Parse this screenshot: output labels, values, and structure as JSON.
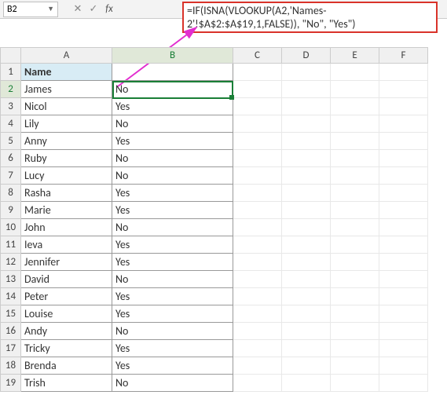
{
  "name_box": {
    "value": "B2"
  },
  "fx": {
    "cancel": "✕",
    "confirm": "✓",
    "label": "fx"
  },
  "formula": "=IF(ISNA(VLOOKUP(A2,'Names-2'!$A$2:$A$19,1,FALSE)), \"No\", \"Yes\")",
  "columns": [
    "A",
    "B",
    "C",
    "D",
    "E",
    "F"
  ],
  "row_numbers": [
    1,
    2,
    3,
    4,
    5,
    6,
    7,
    8,
    9,
    10,
    11,
    12,
    13,
    14,
    15,
    16,
    17,
    18,
    19
  ],
  "header": {
    "name_label": "Name"
  },
  "rows": [
    {
      "name": "James",
      "result": "No"
    },
    {
      "name": "Nicol",
      "result": "Yes"
    },
    {
      "name": "Lily",
      "result": "No"
    },
    {
      "name": "Anny",
      "result": "Yes"
    },
    {
      "name": "Ruby",
      "result": "No"
    },
    {
      "name": "Lucy",
      "result": "No"
    },
    {
      "name": "Rasha",
      "result": "Yes"
    },
    {
      "name": "Marie",
      "result": "Yes"
    },
    {
      "name": "John",
      "result": "No"
    },
    {
      "name": "Ieva",
      "result": "Yes"
    },
    {
      "name": "Jennifer",
      "result": "Yes"
    },
    {
      "name": "David",
      "result": "No"
    },
    {
      "name": "Peter",
      "result": "Yes"
    },
    {
      "name": "Louise",
      "result": "Yes"
    },
    {
      "name": "Andy",
      "result": "No"
    },
    {
      "name": "Tricky",
      "result": "Yes"
    },
    {
      "name": "Brenda",
      "result": "Yes"
    },
    {
      "name": "Trish",
      "result": "No"
    }
  ],
  "selected_cell": "B2"
}
